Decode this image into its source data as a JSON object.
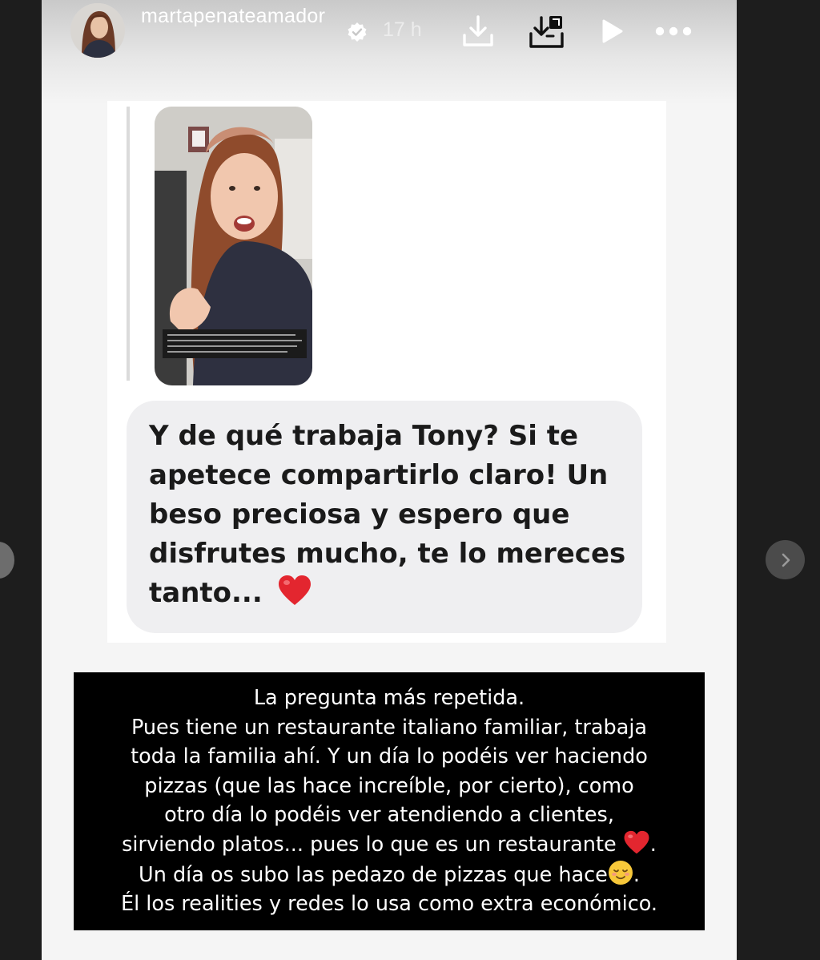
{
  "header": {
    "username": "martapenateamador",
    "time": "17 h",
    "icons": [
      "verified-badge-icon",
      "download-icon",
      "save-download-icon",
      "play-icon",
      "more-icon"
    ]
  },
  "navigation": {
    "prev_icon": "chevron-left-icon",
    "next_icon": "chevron-right-icon"
  },
  "quoted_message": {
    "text_line_1": "Y de qué trabaja Tony? Si te",
    "text_line_2": "apetece compartirlo claro! Un",
    "text_line_3": "beso preciosa y espero que",
    "text_line_4": "disfrutes mucho, te lo mereces",
    "text_line_5": "tanto...",
    "emoji": "red-heart-icon"
  },
  "answer": {
    "line_1": "La pregunta más repetida.",
    "line_2": "Pues tiene un restaurante italiano familiar, trabaja",
    "line_3": "toda la familia ahí. Y un día lo podéis ver haciendo",
    "line_4": "pizzas (que las hace increíble, por cierto), como",
    "line_5": "otro día lo podéis ver atendiendo a clientes,",
    "line_6": "sirviendo platos... pues lo que es un restaurante",
    "line_7a": "Un día os subo las pedazo de pizzas que hace",
    "line_7b": ".",
    "line_8": "Él los realities y redes lo usa como extra económico.",
    "emoji_heart": "red-heart-icon",
    "emoji_face": "relieved-face-icon"
  },
  "colors": {
    "background": "#1d1d1d",
    "story_background": "#f5f5f5",
    "bubble": "#efeff1",
    "answer_box": "#000000",
    "heart": "#e3262f"
  }
}
